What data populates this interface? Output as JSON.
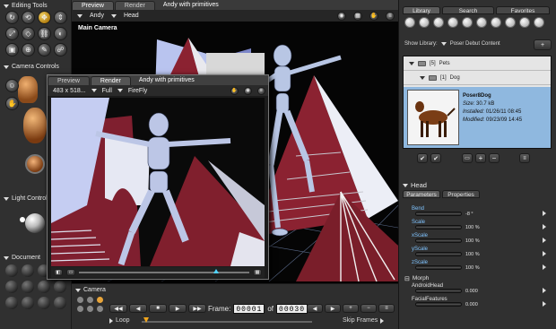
{
  "left_toolbar": {
    "editing_tools_title": "Editing Tools",
    "camera_controls_title": "Camera Controls",
    "light_controls_title": "Light Controls",
    "document_title": "Document"
  },
  "main_window": {
    "tabs": [
      "Preview",
      "Render"
    ],
    "document_title": "Andy with primitives",
    "figure_select": "Andy",
    "part_select": "Head",
    "camera_label": "Main Camera"
  },
  "preview_window": {
    "tabs": [
      "Preview",
      "Render"
    ],
    "document_title": "Andy with primitives",
    "dimensions": "483 x 518...",
    "mode": "Full",
    "renderer": "FireFly"
  },
  "animation": {
    "camera_label": "Camera",
    "frame_label": "Frame:",
    "current_frame": "00001",
    "of_label": "of",
    "total_frames": "00030",
    "loop_label": "Loop",
    "skip_frames_label": "Skip Frames"
  },
  "library": {
    "tabs": [
      "Library",
      "Search",
      "Favorites"
    ],
    "show_library_label": "Show Library:",
    "library_name": "Poser Debut Content",
    "folders": [
      {
        "count": "[5]",
        "name": "Pets"
      },
      {
        "count": "[1]",
        "name": "Dog"
      }
    ],
    "item": {
      "name": "Poser8Dog",
      "size_label": "Size:",
      "size": "30.7 kB",
      "installed_label": "Installed:",
      "installed": "01/26/11 08:45",
      "modified_label": "Modified:",
      "modified": "09/23/09 14:45"
    }
  },
  "parameters": {
    "section_title": "Head",
    "tabs": [
      "Parameters",
      "Properties"
    ],
    "rows": [
      {
        "label": "Bend",
        "value": "-8 °"
      },
      {
        "label": "Scale",
        "value": "100 %"
      },
      {
        "label": "xScale",
        "value": "100 %"
      },
      {
        "label": "yScale",
        "value": "100 %"
      },
      {
        "label": "zScale",
        "value": "100 %"
      }
    ],
    "morph_title": "Morph",
    "morph_rows": [
      {
        "label": "AndroidHead",
        "value": "0.000"
      },
      {
        "label": "FacialFeatures",
        "value": "0.000"
      }
    ]
  },
  "colors": {
    "accent_blue": "#7fc3ff",
    "selection_blue": "#8fb8df",
    "panel_bg": "#303030",
    "gold_button": "#e0b83a"
  }
}
